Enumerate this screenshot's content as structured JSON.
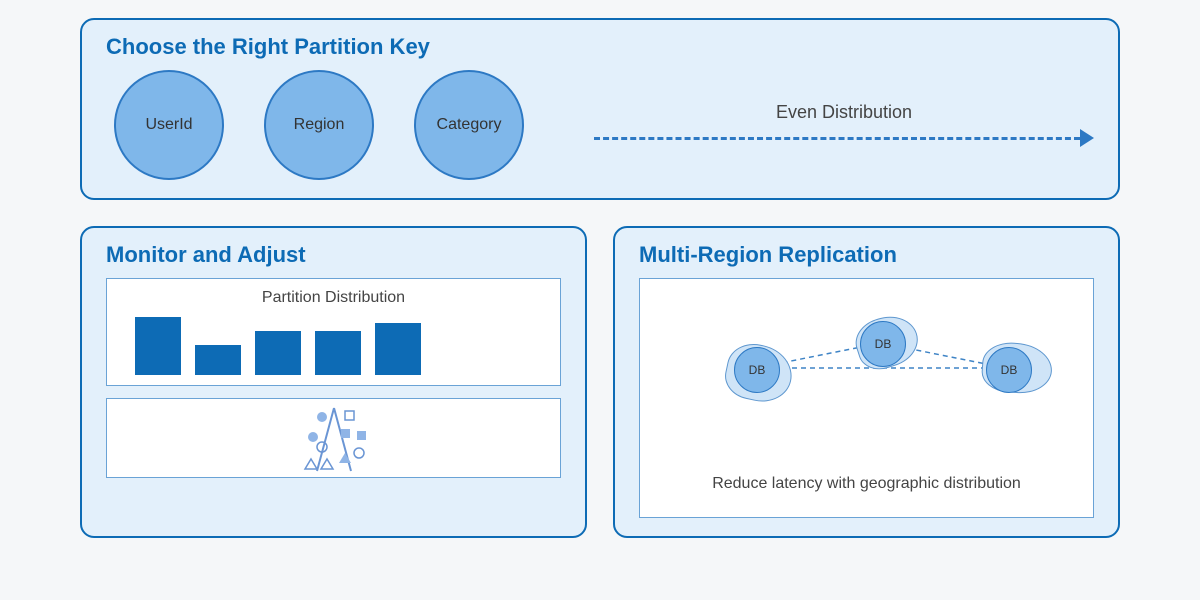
{
  "top": {
    "title": "Choose the Right Partition Key",
    "keys": [
      "UserId",
      "Region",
      "Category"
    ],
    "arrow_label": "Even Distribution"
  },
  "left": {
    "title": "Monitor and Adjust",
    "chart_title": "Partition Distribution"
  },
  "right": {
    "title": "Multi-Region Replication",
    "node_label": "DB",
    "caption": "Reduce latency with geographic distribution"
  },
  "chart_data": {
    "type": "bar",
    "title": "Partition Distribution",
    "categories": [
      "",
      "",
      "",
      "",
      ""
    ],
    "values": [
      58,
      30,
      44,
      44,
      52
    ],
    "xlabel": "",
    "ylabel": "",
    "ylim": [
      0,
      60
    ]
  }
}
